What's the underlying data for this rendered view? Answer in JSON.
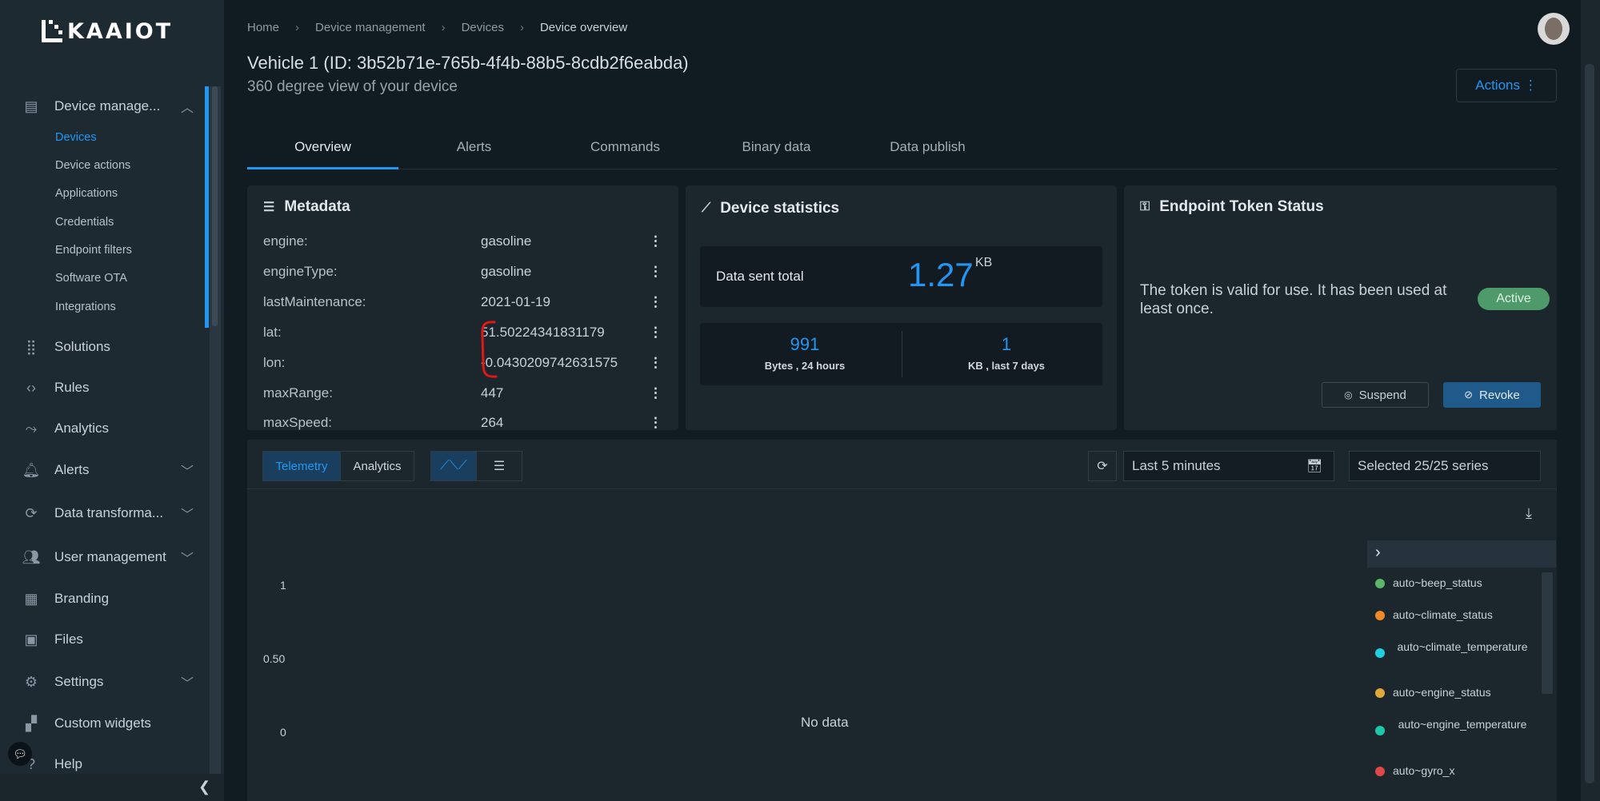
{
  "sidebar": {
    "logo_text": "KAAIOT",
    "device_management": "Device manage...",
    "sub_items": [
      "Devices",
      "Device actions",
      "Applications",
      "Credentials",
      "Endpoint filters",
      "Software OTA",
      "Integrations"
    ],
    "items": {
      "solutions": "Solutions",
      "rules": "Rules",
      "analytics": "Analytics",
      "alerts": "Alerts",
      "data_transformation": "Data transforma...",
      "user_management": "User management",
      "branding": "Branding",
      "files": "Files",
      "settings": "Settings",
      "custom_widgets": "Custom widgets",
      "help": "Help"
    }
  },
  "breadcrumb": [
    "Home",
    "Device management",
    "Devices",
    "Device overview"
  ],
  "page": {
    "title": "Vehicle 1 (ID: 3b52b71e-765b-4f4b-88b5-8cdb2f6eabda)",
    "subtitle": "360 degree view of your device",
    "actions": "Actions ⋮"
  },
  "tabs": [
    "Overview",
    "Alerts",
    "Commands",
    "Binary data",
    "Data publish"
  ],
  "metadata": {
    "title": "Metadata",
    "rows": [
      {
        "k": "engine:",
        "v": "gasoline"
      },
      {
        "k": "engineType:",
        "v": "gasoline"
      },
      {
        "k": "lastMaintenance:",
        "v": "2021-01-19"
      },
      {
        "k": "lat:",
        "v": "51.50224341831179"
      },
      {
        "k": "lon:",
        "v": "-0.0430209742631575"
      },
      {
        "k": "maxRange:",
        "v": "447"
      },
      {
        "k": "maxSpeed:",
        "v": "264"
      }
    ]
  },
  "stats": {
    "title": "Device statistics",
    "total_label": "Data sent total",
    "total_value": "1.27",
    "total_unit": "KB",
    "day_value": "991",
    "day_label": "Bytes , 24 hours",
    "week_value": "1",
    "week_label": "KB , last 7 days"
  },
  "token": {
    "title": "Endpoint Token Status",
    "text": "The token is valid for use. It has been used at least once.",
    "status": "Active",
    "suspend": "Suspend",
    "revoke": "Revoke"
  },
  "toolbar": {
    "telemetry": "Telemetry",
    "analytics": "Analytics",
    "time_range": "Last 5 minutes",
    "series": "Selected 25/25 series"
  },
  "chart": {
    "y_ticks": [
      "1",
      "0.50",
      "0"
    ],
    "no_data": "No data"
  },
  "legend": [
    {
      "name": "auto~beep_status",
      "color": "#5bb86a"
    },
    {
      "name": "auto~climate_status",
      "color": "#f08a24"
    },
    {
      "name": "auto~climate_temperature",
      "color": "#1ed0e0"
    },
    {
      "name": "auto~engine_status",
      "color": "#e0a838"
    },
    {
      "name": "auto~engine_temperature",
      "color": "#19c9a8"
    },
    {
      "name": "auto~gyro_x",
      "color": "#e04848"
    }
  ]
}
